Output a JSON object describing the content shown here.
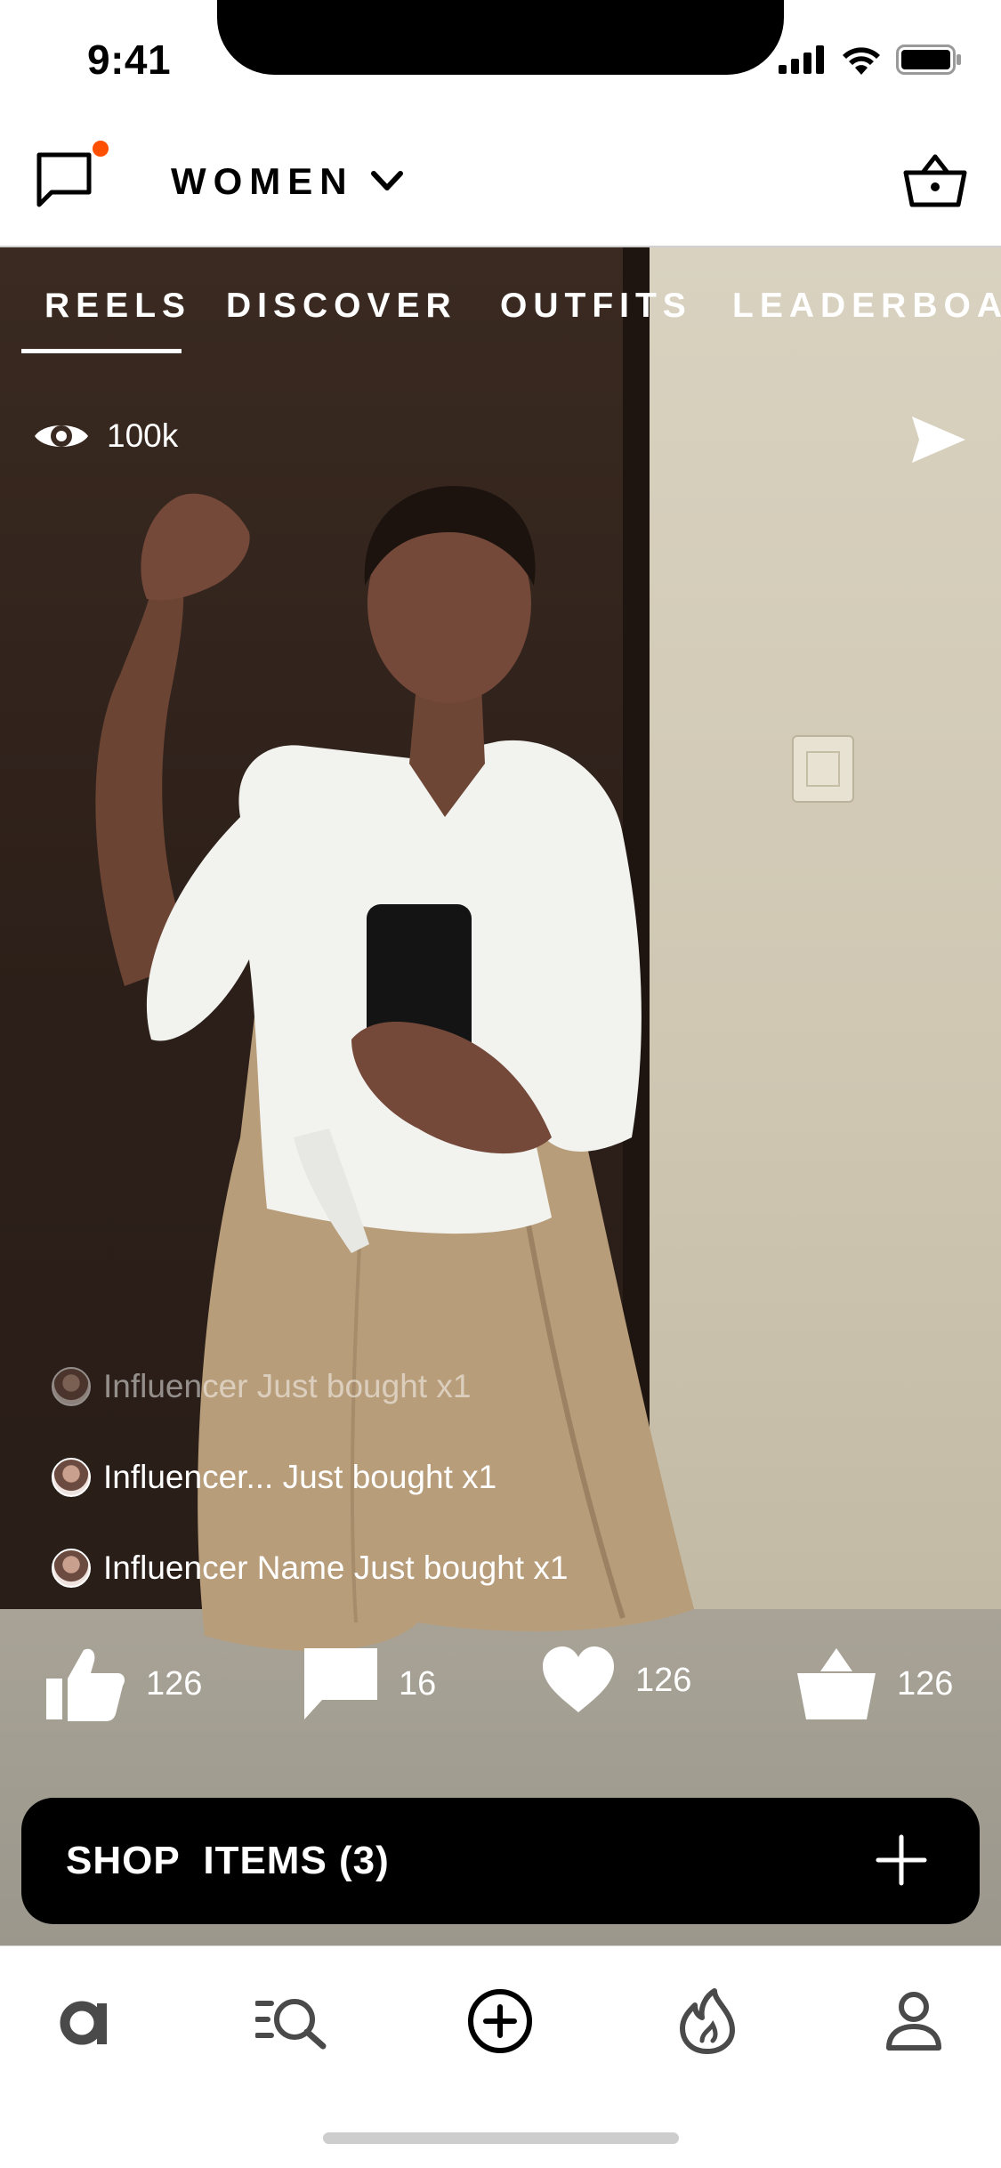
{
  "status_bar": {
    "time": "9:41"
  },
  "header": {
    "gender_label": "WOMEN",
    "accent_color": "#ff4f00"
  },
  "tabs": [
    {
      "label": "REELS",
      "active": true
    },
    {
      "label": "DISCOVER",
      "active": false
    },
    {
      "label": "OUTFITS",
      "active": false
    },
    {
      "label": "LEADERBOARD",
      "active": false
    }
  ],
  "reel": {
    "views": "100k",
    "purchase_feed": [
      {
        "text": "Influencer Just bought x1",
        "faded": true
      },
      {
        "text": "Influencer... Just bought x1",
        "faded": false
      },
      {
        "text": "Influencer Name Just bought x1",
        "faded": false
      }
    ],
    "stats": {
      "likes": "126",
      "comments": "16",
      "favorites": "126",
      "basket": "126"
    }
  },
  "shop_bar": {
    "label": "SHOP  ITEMS (3)"
  },
  "bottom_nav": [
    {
      "icon": "brand-a-icon"
    },
    {
      "icon": "search-list-icon"
    },
    {
      "icon": "add-circle-icon"
    },
    {
      "icon": "flame-icon"
    },
    {
      "icon": "profile-icon"
    }
  ]
}
